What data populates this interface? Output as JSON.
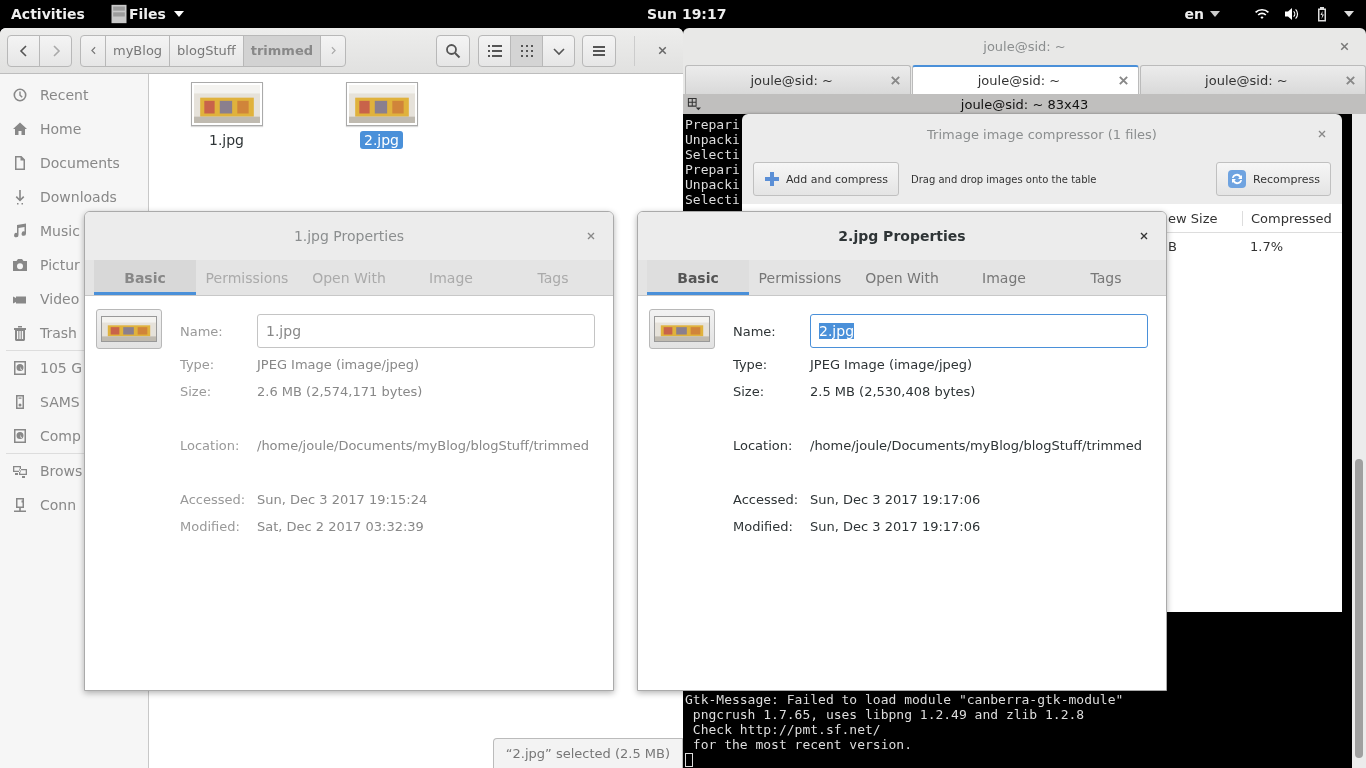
{
  "top_bar": {
    "activities": "Activities",
    "app_menu": "Files",
    "clock": "Sun 19:17",
    "keyboard": "en"
  },
  "files": {
    "path": [
      {
        "label": "myBlog",
        "selected": false
      },
      {
        "label": "blogStuff",
        "selected": false
      },
      {
        "label": "trimmed",
        "selected": true
      }
    ],
    "view_modes": [
      {
        "kind": "list",
        "selected": false
      },
      {
        "kind": "grid",
        "selected": true
      }
    ],
    "sidebar": {
      "places": [
        {
          "label": "Recent",
          "kind": "recent"
        },
        {
          "label": "Home",
          "kind": "home"
        },
        {
          "label": "Documents",
          "kind": "document"
        },
        {
          "label": "Downloads",
          "kind": "download"
        },
        {
          "label": "Music",
          "kind": "music"
        },
        {
          "label": "Pictur",
          "kind": "camera"
        },
        {
          "label": "Video",
          "kind": "video"
        },
        {
          "label": "Trash",
          "kind": "trash"
        }
      ],
      "devices": [
        {
          "label": "105 G",
          "kind": "disk"
        },
        {
          "label": "SAMS",
          "kind": "drive"
        },
        {
          "label": "Comp",
          "kind": "disk"
        }
      ],
      "network": [
        {
          "label": "Brows",
          "kind": "network"
        },
        {
          "label": "Conn",
          "kind": "server"
        }
      ]
    },
    "items": [
      {
        "name": "1.jpg",
        "selected": false
      },
      {
        "name": "2.jpg",
        "selected": true
      }
    ],
    "status": "“2.jpg” selected (2.5 MB)"
  },
  "terminal": {
    "title": "joule@sid: ~",
    "tabs": [
      {
        "label": "joule@sid: ~",
        "selected": false
      },
      {
        "label": "joule@sid: ~",
        "selected": true
      },
      {
        "label": "joule@sid: ~",
        "selected": false
      }
    ],
    "subtitle": "joule@sid: ~ 83x43",
    "lines_top": [
      "Prepari",
      "Unpacki",
      "Selecti",
      "Prepari",
      "Unpacki",
      "Selecti"
    ],
    "lines_bottom": [
      "Gtk-Message: Failed to load module \"canberra-gtk-module\"",
      " pngcrush 1.7.65, uses libpng 1.2.49 and zlib 1.2.8",
      " Check http://pmt.sf.net/",
      " for the most recent version."
    ]
  },
  "trimage": {
    "title": "Trimage image compressor (1 files)",
    "add_button": "Add and compress",
    "hint": "Drag and drop images onto the table",
    "recompress_button": "Recompress",
    "columns": [
      "ew Size",
      "Compressed"
    ],
    "row": [
      "B",
      "1.7%"
    ]
  },
  "dialogs": [
    {
      "title": "1.jpg Properties",
      "active": false,
      "tabs": [
        {
          "label": "Basic",
          "selected": true
        },
        {
          "label": "Permissions",
          "selected": false
        },
        {
          "label": "Open With",
          "selected": false
        },
        {
          "label": "Image",
          "selected": false
        },
        {
          "label": "Tags",
          "selected": false
        }
      ],
      "name_label": "Name:",
      "name_value": "1.jpg",
      "name_selected": false,
      "groups": [
        [
          {
            "label": "Type:",
            "value": "JPEG Image (image/jpeg)"
          },
          {
            "label": "Size:",
            "value": "2.6 MB (2,574,171 bytes)"
          }
        ],
        [
          {
            "label": "Location:",
            "value": "/home/joule/Documents/myBlog/blogStuff/trimmed"
          }
        ],
        [
          {
            "label": "Accessed:",
            "value": "Sun, Dec  3 2017 19:15:24"
          },
          {
            "label": "Modified:",
            "value": "Sat, Dec  2 2017 03:32:39"
          }
        ]
      ]
    },
    {
      "title": "2.jpg Properties",
      "active": true,
      "tabs": [
        {
          "label": "Basic",
          "selected": true
        },
        {
          "label": "Permissions",
          "selected": false
        },
        {
          "label": "Open With",
          "selected": false
        },
        {
          "label": "Image",
          "selected": false
        },
        {
          "label": "Tags",
          "selected": false
        }
      ],
      "name_label": "Name:",
      "name_value": "2.jpg",
      "name_selected": true,
      "groups": [
        [
          {
            "label": "Type:",
            "value": "JPEG Image (image/jpeg)"
          },
          {
            "label": "Size:",
            "value": "2.5 MB (2,530,408 bytes)"
          }
        ],
        [
          {
            "label": "Location:",
            "value": "/home/joule/Documents/myBlog/blogStuff/trimmed"
          }
        ],
        [
          {
            "label": "Accessed:",
            "value": "Sun, Dec  3 2017 19:17:06"
          },
          {
            "label": "Modified:",
            "value": "Sun, Dec  3 2017 19:17:06"
          }
        ]
      ]
    }
  ]
}
